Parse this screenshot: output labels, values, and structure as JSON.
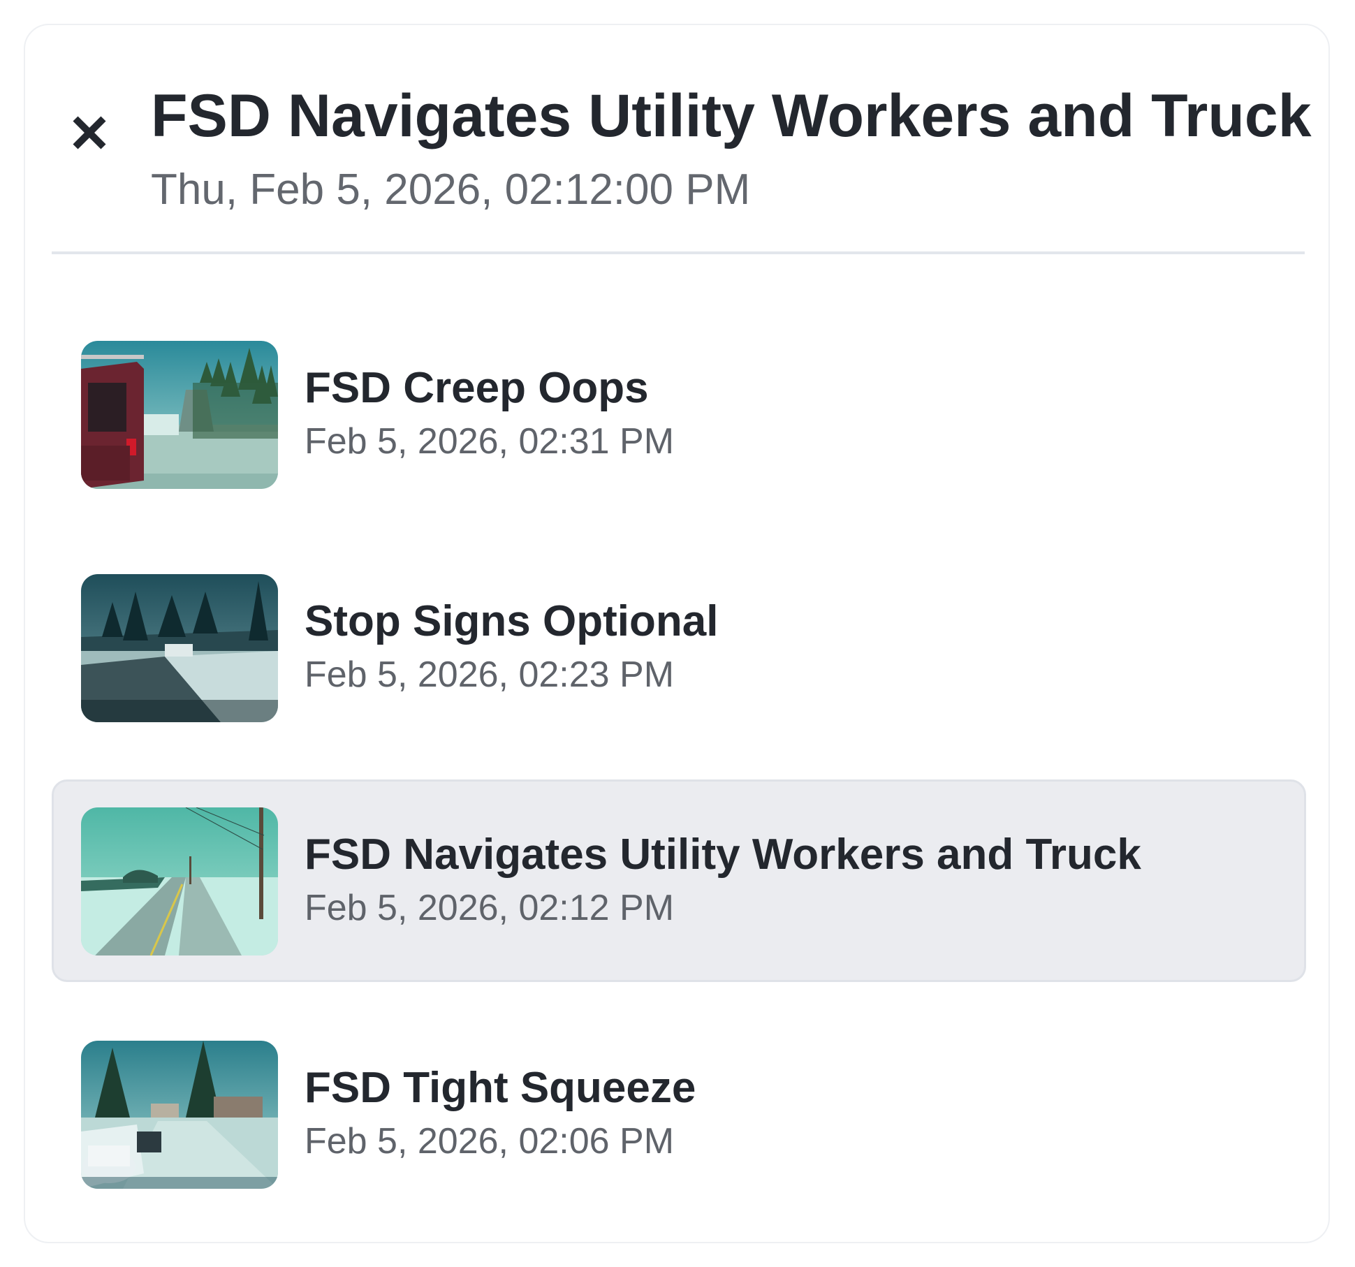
{
  "header": {
    "title": "FSD Navigates Utility Workers and Truck",
    "subtitle": "Thu, Feb 5, 2026, 02:12:00 PM",
    "close_icon": "close-icon"
  },
  "items": [
    {
      "title": "FSD Creep Oops",
      "date": "Feb 5, 2026, 02:31 PM",
      "selected": false
    },
    {
      "title": "Stop Signs Optional",
      "date": "Feb 5, 2026, 02:23 PM",
      "selected": false
    },
    {
      "title": "FSD Navigates Utility Workers and Truck",
      "date": "Feb 5, 2026, 02:12 PM",
      "selected": true
    },
    {
      "title": "FSD Tight Squeeze",
      "date": "Feb 5, 2026, 02:06 PM",
      "selected": false
    }
  ],
  "colors": {
    "selected_bg": "#ebecf0",
    "text_primary": "#23272e",
    "text_secondary": "#5f636a"
  }
}
